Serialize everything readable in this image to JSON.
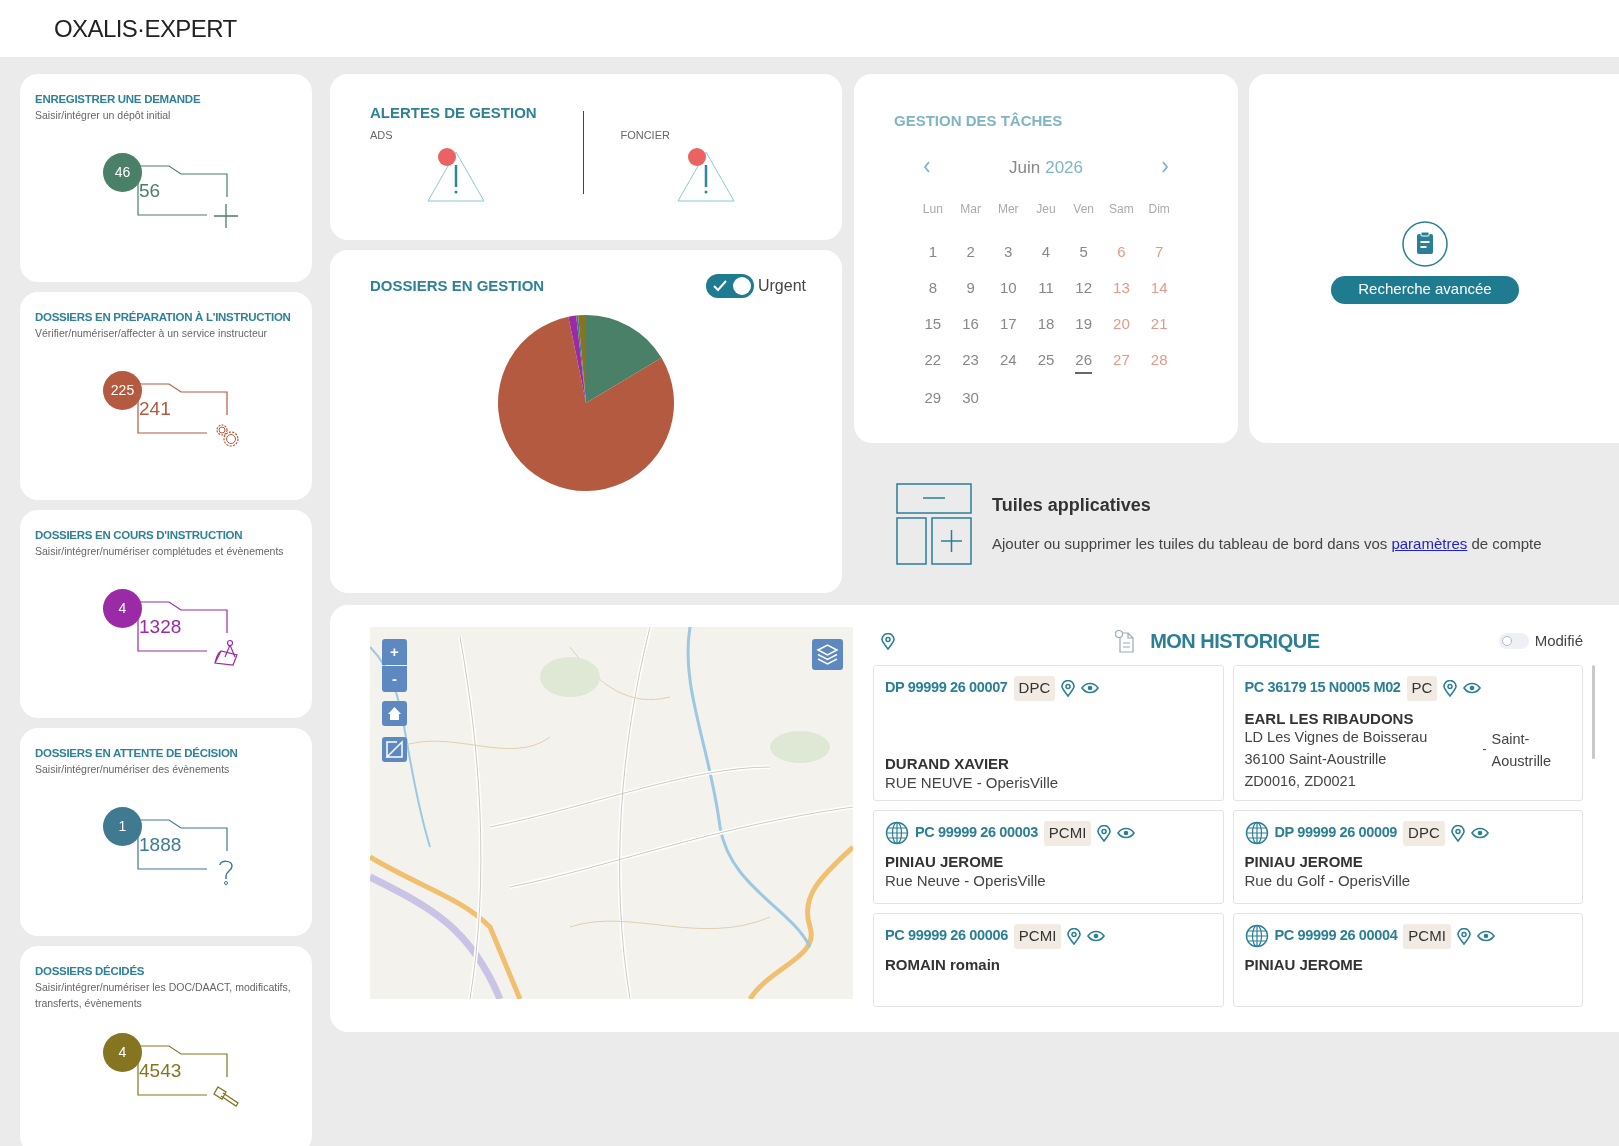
{
  "header": {
    "logo": "OXALIS·EXPERT"
  },
  "workflow_cards": [
    {
      "title": "ENREGISTRER UNE DEMANDE",
      "subtitle": "Saisir/intégrer un dépôt initial",
      "badge": "46",
      "count": "56",
      "color": "#4a7f68",
      "kind": "plus"
    },
    {
      "title": "DOSSIERS EN PRÉPARATION À L'INSTRUCTION",
      "subtitle": "Vérifier/numériser/affecter à un service instructeur",
      "badge": "225",
      "count": "241",
      "color": "#b35a40",
      "kind": "gears"
    },
    {
      "title": "DOSSIERS EN COURS D'INSTRUCTION",
      "subtitle": "Saisir/intégrer/numériser complétudes et évènements",
      "badge": "4",
      "count": "1328",
      "color": "#9b2aa6",
      "kind": "survey"
    },
    {
      "title": "DOSSIERS EN ATTENTE DE DÉCISION",
      "subtitle": "Saisir/intégrer/numériser des évènements",
      "badge": "1",
      "count": "1888",
      "color": "#3f7a90",
      "kind": "question"
    },
    {
      "title": "DOSSIERS DÉCIDÉS",
      "subtitle": "Saisir/intégrer/numériser les DOC/DAACT, modificatifs, transferts, évènements",
      "badge": "4",
      "count": "4543",
      "color": "#857520",
      "kind": "gavel"
    }
  ],
  "alerts": {
    "title": "ALERTES DE GESTION",
    "groups": [
      {
        "label": "ADS",
        "alert": true
      },
      {
        "label": "FONCIER",
        "alert": true
      }
    ]
  },
  "dossiers": {
    "title": "DOSSIERS EN GESTION",
    "toggle": {
      "label": "Urgent",
      "on": true
    }
  },
  "tasks": {
    "title": "GESTION DES TÂCHES",
    "month": "Juin",
    "year": "2026",
    "weekdays": [
      "Lun",
      "Mar",
      "Mer",
      "Jeu",
      "Ven",
      "Sam",
      "Dim"
    ],
    "days": [
      {
        "label": "1",
        "weekend": false,
        "today": false
      },
      {
        "label": "2",
        "weekend": false,
        "today": false
      },
      {
        "label": "3",
        "weekend": false,
        "today": false
      },
      {
        "label": "4",
        "weekend": false,
        "today": false
      },
      {
        "label": "5",
        "weekend": false,
        "today": false
      },
      {
        "label": "6",
        "weekend": true,
        "today": false
      },
      {
        "label": "7",
        "weekend": true,
        "today": false
      },
      {
        "label": "8",
        "weekend": false,
        "today": false
      },
      {
        "label": "9",
        "weekend": false,
        "today": false
      },
      {
        "label": "10",
        "weekend": false,
        "today": false
      },
      {
        "label": "11",
        "weekend": false,
        "today": false
      },
      {
        "label": "12",
        "weekend": false,
        "today": false
      },
      {
        "label": "13",
        "weekend": true,
        "today": false
      },
      {
        "label": "14",
        "weekend": true,
        "today": false
      },
      {
        "label": "15",
        "weekend": false,
        "today": false
      },
      {
        "label": "16",
        "weekend": false,
        "today": false
      },
      {
        "label": "17",
        "weekend": false,
        "today": false
      },
      {
        "label": "18",
        "weekend": false,
        "today": false
      },
      {
        "label": "19",
        "weekend": false,
        "today": false
      },
      {
        "label": "20",
        "weekend": true,
        "today": false
      },
      {
        "label": "21",
        "weekend": true,
        "today": false
      },
      {
        "label": "22",
        "weekend": false,
        "today": false
      },
      {
        "label": "23",
        "weekend": false,
        "today": false
      },
      {
        "label": "24",
        "weekend": false,
        "today": false
      },
      {
        "label": "25",
        "weekend": false,
        "today": false
      },
      {
        "label": "26",
        "weekend": false,
        "today": true
      },
      {
        "label": "27",
        "weekend": true,
        "today": false
      },
      {
        "label": "28",
        "weekend": true,
        "today": false
      },
      {
        "label": "29",
        "weekend": false,
        "today": false
      },
      {
        "label": "30",
        "weekend": false,
        "today": false
      }
    ]
  },
  "advanced_search": {
    "label": "Recherche avancée"
  },
  "tiles_info": {
    "title": "Tuiles applicatives",
    "text_before": "Ajouter ou supprimer les tuiles du tableau de bord dans vos",
    "link": "paramètres",
    "text_after": "de compte"
  },
  "map": {
    "zoom_in": "+",
    "zoom_out": "-"
  },
  "history": {
    "title": "MON HISTORIQUE",
    "toggle": {
      "label": "Modifié",
      "on": false
    },
    "items": [
      {
        "number": "DP 99999 26 00007",
        "type": "DPC",
        "online": false,
        "name": "DURAND XAVIER",
        "address": [
          "RUE NEUVE - OperisVille"
        ]
      },
      {
        "number": "PC 36179 15 N0005 M02",
        "type": "PC",
        "online": false,
        "name": "EARL LES RIBAUDONS",
        "address": [
          "LD Les Vignes de Boisserau",
          "36100 Saint-Aoustrille"
        ],
        "side": {
          "dash": "-",
          "text": "Saint-Aoustrille"
        },
        "parcels": "ZD0016, ZD0021"
      },
      {
        "number": "PC 99999 26 00003",
        "type": "PCMI",
        "online": true,
        "name": "PINIAU JEROME",
        "address": [
          "Rue Neuve - OperisVille"
        ]
      },
      {
        "number": "DP 99999 26 00009",
        "type": "DPC",
        "online": true,
        "name": "PINIAU JEROME",
        "address": [
          "Rue du Golf - OperisVille"
        ]
      },
      {
        "number": "PC 99999 26 00006",
        "type": "PCMI",
        "online": false,
        "name": "ROMAIN romain"
      },
      {
        "number": "PC 99999 26 00004",
        "type": "PCMI",
        "online": true,
        "name": "PINIAU JEROME"
      }
    ]
  }
}
